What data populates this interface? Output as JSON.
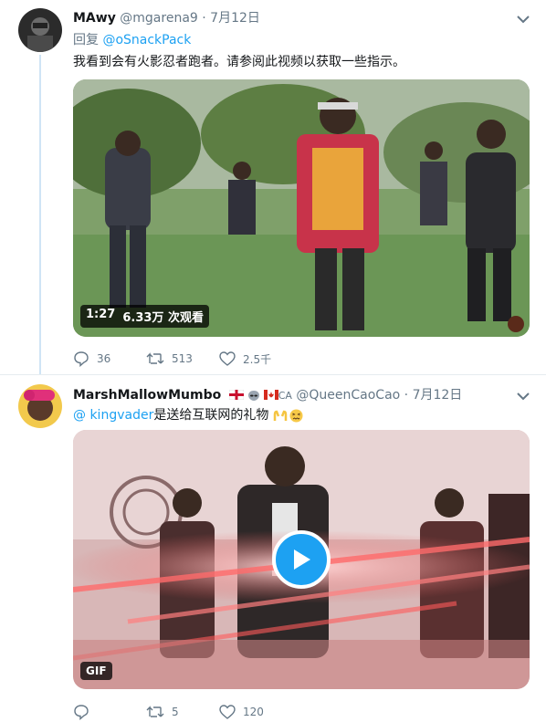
{
  "tweet1": {
    "display_name": "MAwy",
    "handle": "@mgarena9",
    "dot": "·",
    "date": "7月12日",
    "reply_prefix": "回复",
    "reply_to": "@oSnackPack",
    "text": "我看到会有火影忍者跑者。请参阅此视频以获取一些指示。",
    "video_duration": "1:27",
    "video_views": "6.33万 次观看",
    "replies": "36",
    "retweets": "513",
    "likes": "2.5千",
    "chevron_icon": "chevron-down-icon"
  },
  "tweet2": {
    "display_name": "MarshMallowMumbo",
    "flag_suffix": "CA",
    "handle": "@QueenCaoCao",
    "dot": "·",
    "date": "7月12日",
    "mention": "@ kingvader",
    "text": "是送给互联网的礼物",
    "gif_label": "GIF",
    "replies": "",
    "retweets": "5",
    "likes": "120",
    "chevron_icon": "chevron-down-icon"
  },
  "colors": {
    "accent": "#1da1f2",
    "secondary_text": "#657786",
    "thread_line": "#cfe4f5"
  }
}
